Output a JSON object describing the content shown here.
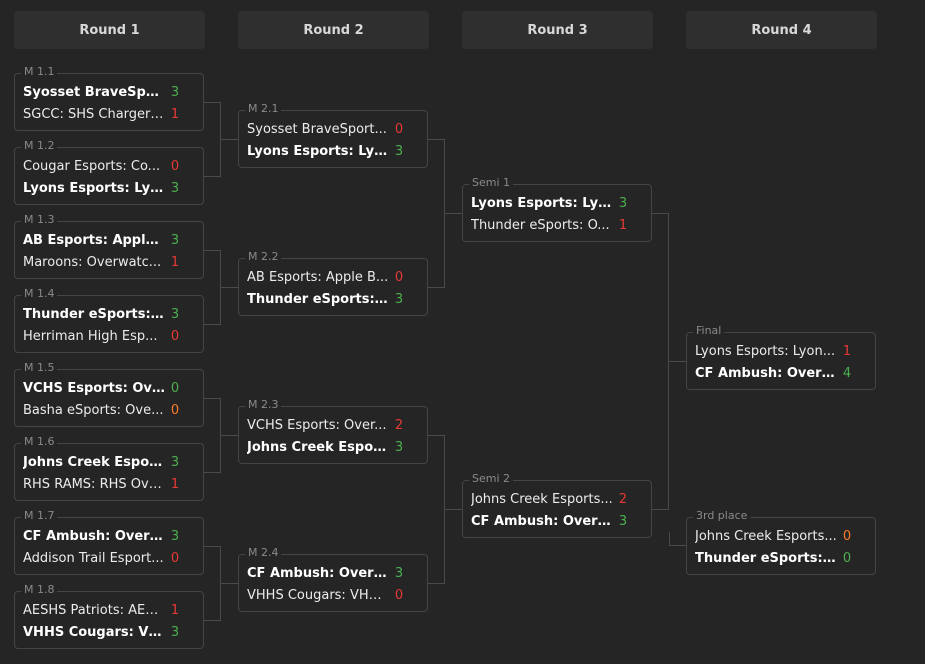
{
  "rounds": [
    {
      "title": "Round 1"
    },
    {
      "title": "Round 2"
    },
    {
      "title": "Round 3"
    },
    {
      "title": "Round 4"
    }
  ],
  "colors": {
    "win": "#4caf50",
    "loss": "#e53935",
    "tie": "#ff7a29"
  },
  "matches": {
    "m1_1": {
      "label": "M 1.1",
      "teams": [
        {
          "name": "Syosset BraveSports...",
          "score": "3",
          "result": "win",
          "winner": true
        },
        {
          "name": "SGCC: SHS Chargers...",
          "score": "1",
          "result": "loss",
          "winner": false
        }
      ]
    },
    "m1_2": {
      "label": "M 1.2",
      "teams": [
        {
          "name": "Cougar Esports: Co...",
          "score": "0",
          "result": "loss",
          "winner": false
        },
        {
          "name": "Lyons Esports: Lyo...",
          "score": "3",
          "result": "win",
          "winner": true
        }
      ]
    },
    "m1_3": {
      "label": "M 1.3",
      "teams": [
        {
          "name": "AB Esports: Apple ...",
          "score": "3",
          "result": "win",
          "winner": true
        },
        {
          "name": "Maroons: Overwatc...",
          "score": "1",
          "result": "loss",
          "winner": false
        }
      ]
    },
    "m1_4": {
      "label": "M 1.4",
      "teams": [
        {
          "name": "Thunder eSports: ...",
          "score": "3",
          "result": "win",
          "winner": true
        },
        {
          "name": "Herriman High Esp...",
          "score": "0",
          "result": "loss",
          "winner": false
        }
      ]
    },
    "m1_5": {
      "label": "M 1.5",
      "teams": [
        {
          "name": "VCHS Esports: Ove...",
          "score": "0",
          "result": "win",
          "winner": true
        },
        {
          "name": "Basha eSports: Ove...",
          "score": "0",
          "result": "tie",
          "winner": false
        }
      ]
    },
    "m1_6": {
      "label": "M 1.6",
      "teams": [
        {
          "name": "Johns Creek Esport...",
          "score": "3",
          "result": "win",
          "winner": true
        },
        {
          "name": "RHS RAMS: RHS Ove...",
          "score": "1",
          "result": "loss",
          "winner": false
        }
      ]
    },
    "m1_7": {
      "label": "M 1.7",
      "teams": [
        {
          "name": "CF Ambush: Overw...",
          "score": "3",
          "result": "win",
          "winner": true
        },
        {
          "name": "Addison Trail Esport...",
          "score": "0",
          "result": "loss",
          "winner": false
        }
      ]
    },
    "m1_8": {
      "label": "M 1.8",
      "teams": [
        {
          "name": "AESHS Patriots: AES...",
          "score": "1",
          "result": "loss",
          "winner": false
        },
        {
          "name": "VHHS Cougars: VH...",
          "score": "3",
          "result": "win",
          "winner": true
        }
      ]
    },
    "m2_1": {
      "label": "M 2.1",
      "teams": [
        {
          "name": "Syosset BraveSport...",
          "score": "0",
          "result": "loss",
          "winner": false
        },
        {
          "name": "Lyons Esports: Lyo...",
          "score": "3",
          "result": "win",
          "winner": true
        }
      ]
    },
    "m2_2": {
      "label": "M 2.2",
      "teams": [
        {
          "name": "AB Esports: Apple B...",
          "score": "0",
          "result": "loss",
          "winner": false
        },
        {
          "name": "Thunder eSports: ...",
          "score": "3",
          "result": "win",
          "winner": true
        }
      ]
    },
    "m2_3": {
      "label": "M 2.3",
      "teams": [
        {
          "name": "VCHS Esports: Over...",
          "score": "2",
          "result": "loss",
          "winner": false
        },
        {
          "name": "Johns Creek Esport...",
          "score": "3",
          "result": "win",
          "winner": true
        }
      ]
    },
    "m2_4": {
      "label": "M 2.4",
      "teams": [
        {
          "name": "CF Ambush: Overw...",
          "score": "3",
          "result": "win",
          "winner": true
        },
        {
          "name": "VHHS Cougars: VHH...",
          "score": "0",
          "result": "loss",
          "winner": false
        }
      ]
    },
    "semi1": {
      "label": "Semi 1",
      "teams": [
        {
          "name": "Lyons Esports: Lyo...",
          "score": "3",
          "result": "win",
          "winner": true
        },
        {
          "name": "Thunder eSports: O...",
          "score": "1",
          "result": "loss",
          "winner": false
        }
      ]
    },
    "semi2": {
      "label": "Semi 2",
      "teams": [
        {
          "name": "Johns Creek Esports...",
          "score": "2",
          "result": "loss",
          "winner": false
        },
        {
          "name": "CF Ambush: Overw...",
          "score": "3",
          "result": "win",
          "winner": true
        }
      ]
    },
    "final": {
      "label": "Final",
      "teams": [
        {
          "name": "Lyons Esports: Lyon...",
          "score": "1",
          "result": "loss",
          "winner": false
        },
        {
          "name": "CF Ambush: Overw...",
          "score": "4",
          "result": "win",
          "winner": true
        }
      ]
    },
    "third": {
      "label": "3rd place",
      "teams": [
        {
          "name": "Johns Creek Esports...",
          "score": "0",
          "result": "tie",
          "winner": false
        },
        {
          "name": "Thunder eSports: ...",
          "score": "0",
          "result": "win",
          "winner": true
        }
      ]
    }
  }
}
